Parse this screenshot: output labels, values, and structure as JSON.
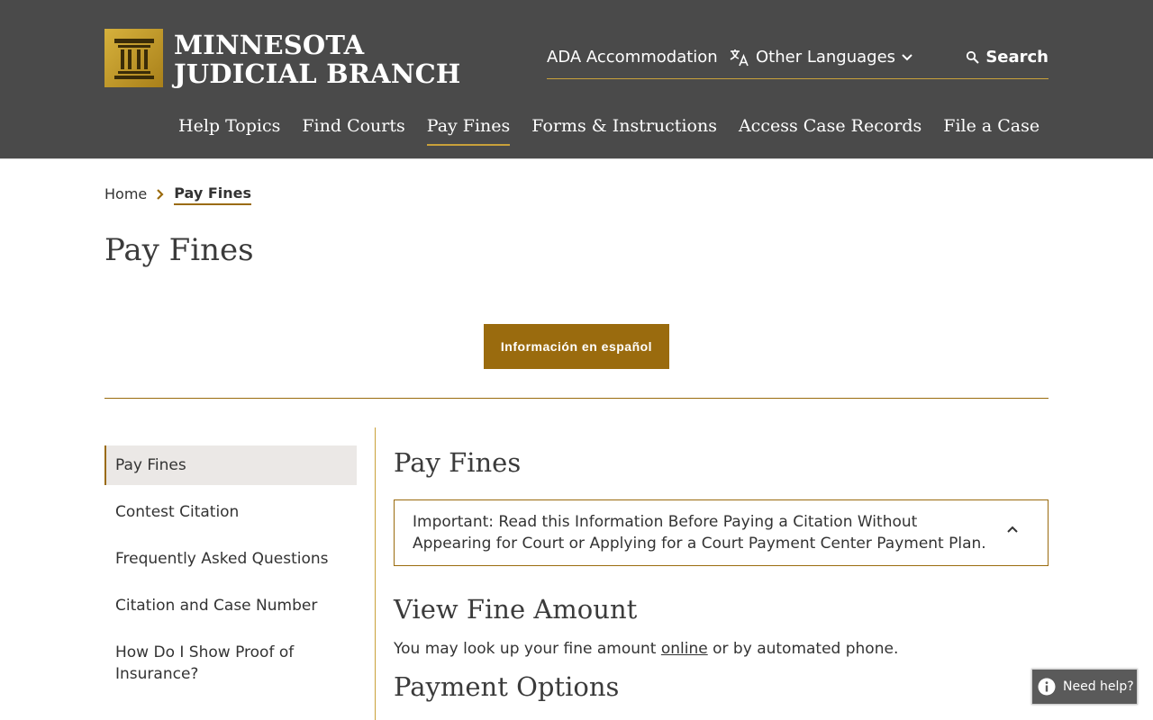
{
  "logo": {
    "line1": "MINNESOTA",
    "line2": "JUDICIAL BRANCH",
    "icon": "courthouse-icon",
    "color": "#c9a13a"
  },
  "utility": {
    "ada": "ADA Accommodation",
    "languages": "Other Languages",
    "search": "Search"
  },
  "nav": [
    {
      "label": "Help Topics"
    },
    {
      "label": "Find Courts"
    },
    {
      "label": "Pay Fines",
      "active": true
    },
    {
      "label": "Forms & Instructions"
    },
    {
      "label": "Access Case Records"
    },
    {
      "label": "File a Case"
    }
  ],
  "breadcrumb": {
    "home": "Home",
    "current": "Pay Fines"
  },
  "page_title": "Pay Fines",
  "spanish_button": "Información en español",
  "sidebar": [
    {
      "label": "Pay Fines",
      "active": true
    },
    {
      "label": "Contest Citation"
    },
    {
      "label": "Frequently Asked Questions"
    },
    {
      "label": "Citation and Case Number"
    },
    {
      "label": "How Do I Show Proof of Insurance?"
    }
  ],
  "content": {
    "heading": "Pay Fines",
    "accordion_text": "Important: Read this Information Before Paying a Citation Without Appearing for Court or Applying for a Court Payment Center Payment Plan.",
    "view_heading": "View Fine Amount",
    "view_text_before": "You may look up your fine amount ",
    "view_link": "online",
    "view_text_after": " or by automated phone.",
    "payment_heading": "Payment Options"
  },
  "help_button": "Need help?",
  "colors": {
    "header_bg": "#4a4a4a",
    "accent": "#9a6b0e",
    "gold": "#c9a13a"
  }
}
